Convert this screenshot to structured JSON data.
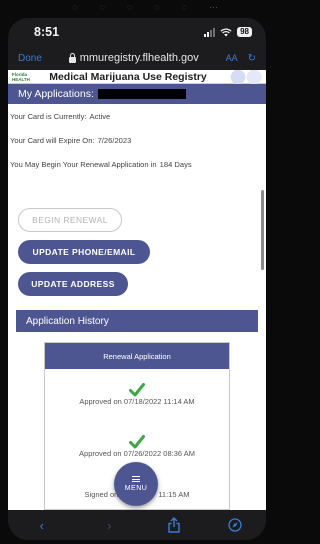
{
  "status_bar": {
    "time": "8:51",
    "battery": "98"
  },
  "browser": {
    "done_label": "Done",
    "url": "mmuregistry.flhealth.gov",
    "aa_label": "AA"
  },
  "registry": {
    "logo_text": "Florida HEALTH",
    "title": "Medical Marijuana Use Registry"
  },
  "applications": {
    "header": "My Applications:",
    "card_status_label": "Your Card is Currently:",
    "card_status_value": "Active",
    "expire_label": "Your Card will Expire On:",
    "expire_value": "7/26/2023",
    "renewal_label": "You May Begin Your Renewal Application in",
    "renewal_value": "184 Days"
  },
  "buttons": {
    "begin_renewal": "BEGIN RENEWAL",
    "update_phone": "UPDATE PHONE/EMAIL",
    "update_address": "UPDATE ADDRESS"
  },
  "history": {
    "header": "Application History",
    "card_title": "Renewal Application",
    "entries": [
      {
        "text": "Approved on 07/18/2022 11:14 AM",
        "icon": "check-icon"
      },
      {
        "text": "Approved on 07/26/2022 08:36 AM",
        "icon": "check-icon"
      }
    ],
    "signed_prefix": "Signed on",
    "signed_suffix": "11:15 AM"
  },
  "menu_label": "MENU",
  "colors": {
    "accent": "#4e5691",
    "check": "#3aa845",
    "browser_blue": "#3a7bd5"
  }
}
